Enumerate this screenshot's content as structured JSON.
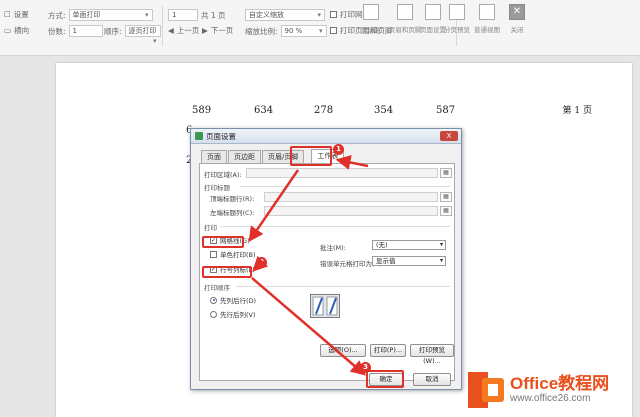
{
  "toolbar": {
    "settings": "设置",
    "landscape": "横向",
    "method_label": "方式:",
    "method_value": "单面打印",
    "copies_label": "份数:",
    "copies_value": "1",
    "order_label": "顺序:",
    "order_value": "逐页打印",
    "page_value": "1",
    "page_total": "共 1 页",
    "prev_page": "上一页",
    "next_page": "下一页",
    "custom_zoom": "自定义缩放",
    "zoom_label": "缩放比例:",
    "zoom_value": "90 %",
    "print_gridlines": "打印网格线",
    "print_header_footer": "打印页眉和页脚",
    "margins": "页边距",
    "header_footer": "页眉和页脚",
    "page_setup": "页面设置",
    "page_break_preview": "分页预览",
    "normal_view": "普通视图",
    "close": "关闭"
  },
  "paper": {
    "numbers": [
      "589",
      "634",
      "278",
      "354",
      "587"
    ],
    "page_label": "第 1 页",
    "frag1": "6",
    "frag2": "2"
  },
  "dialog": {
    "title": "页面设置",
    "close_label": "X",
    "tabs": [
      {
        "label": "页面"
      },
      {
        "label": "页边距"
      },
      {
        "label": "页眉/页脚"
      },
      {
        "label": "工作表"
      }
    ],
    "print_area_label": "打印区域(A):",
    "print_titles_group": "打印标题",
    "top_rows_label": "顶端标题行(R):",
    "left_cols_label": "左端标题列(C):",
    "print_group": "打印",
    "gridlines_label": "网格线(G)",
    "mono_label": "单色打印(B)",
    "rowcol_label": "行号列标(L)",
    "comments_label": "批注(M):",
    "comments_value": "(无)",
    "errors_label": "错误单元格打印为(E):",
    "errors_value": "显示值",
    "order_group": "打印顺序",
    "down_then_over": "先列后行(D)",
    "over_then_down": "先行后列(V)",
    "options_btn": "选项(O)...",
    "print_btn": "打印(P)...",
    "preview_btn": "打印预览(W)...",
    "ok_btn": "确定",
    "cancel_btn": "取消"
  },
  "badges": [
    "1",
    "2",
    "3"
  ],
  "watermark": {
    "brand": "Office教程网",
    "url": "www.office26.com"
  },
  "colors": {
    "highlight": "#e0302a",
    "brand": "#e8501d"
  }
}
